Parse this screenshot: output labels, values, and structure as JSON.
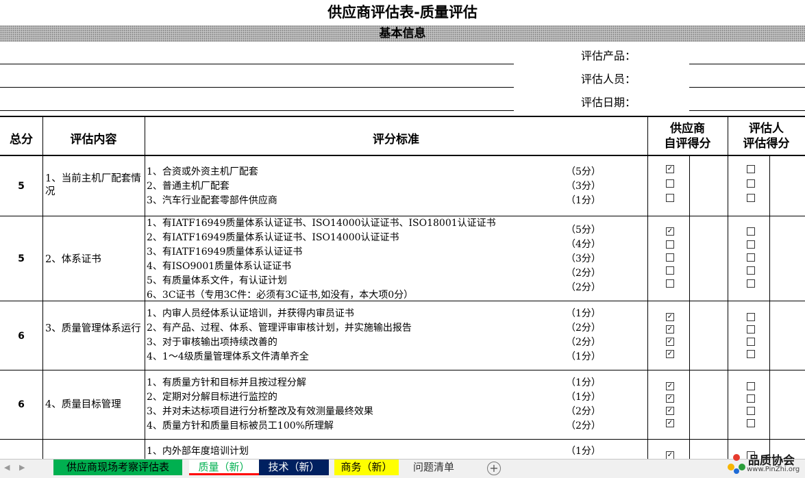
{
  "title": "供应商评估表-质量评估",
  "section_basic": "基本信息",
  "info_labels": [
    "评估产品：",
    "评估人员：",
    "评估日期："
  ],
  "headers": {
    "total": "总分",
    "content": "评估内容",
    "criteria": "评分标准",
    "supplier_line1": "供应商",
    "supplier_line2": "自评得分",
    "assessor_line1": "评估人",
    "assessor_line2": "评估得分"
  },
  "rows": [
    {
      "score": "5",
      "content": "1、当前主机厂配套情况",
      "items": [
        {
          "text": "1、合资或外资主机厂配套",
          "points": "（5分）",
          "supplier_checked": true,
          "assessor_checked": false
        },
        {
          "text": "2、普通主机厂配套",
          "points": "（3分）",
          "supplier_checked": false,
          "assessor_checked": false
        },
        {
          "text": "3、汽车行业配套零部件供应商",
          "points": "（1分）",
          "supplier_checked": false,
          "assessor_checked": false
        }
      ]
    },
    {
      "score": "5",
      "content": "2、体系证书",
      "items": [
        {
          "text": "1、有IATF16949质量体系认证证书、ISO14000认证证书、ISO18001认证证书",
          "points": "（5分）",
          "supplier_checked": true,
          "assessor_checked": false
        },
        {
          "text": "2、有IATF16949质量体系认证证书、ISO14000认证证书",
          "points": "（4分）",
          "supplier_checked": false,
          "assessor_checked": false
        },
        {
          "text": "3、有IATF16949质量体系认证证书",
          "points": "（3分）",
          "supplier_checked": false,
          "assessor_checked": false
        },
        {
          "text": "4、有ISO9001质量体系认证证书",
          "points": "（2分）",
          "supplier_checked": false,
          "assessor_checked": false
        },
        {
          "text": "5、有质量体系文件，有认证计划",
          "points": "（2分）",
          "supplier_checked": false,
          "assessor_checked": false
        },
        {
          "text": "6、3C证书（专用3C件：必须有3C证书,如没有，本大项0分）",
          "points": "",
          "supplier_checked": null,
          "assessor_checked": null
        }
      ]
    },
    {
      "score": "6",
      "content": "3、质量管理体系运行",
      "items": [
        {
          "text": "1、内审人员经体系认证培训，并获得内审员证书",
          "points": "（1分）",
          "supplier_checked": true,
          "assessor_checked": false
        },
        {
          "text": "2、有产品、过程、体系、管理评审审核计划，并实施输出报告",
          "points": "（2分）",
          "supplier_checked": true,
          "assessor_checked": false
        },
        {
          "text": "3、对于审核输出项持续改善的",
          "points": "（2分）",
          "supplier_checked": true,
          "assessor_checked": false
        },
        {
          "text": "4、1～4级质量管理体系文件清单齐全",
          "points": "（1分）",
          "supplier_checked": true,
          "assessor_checked": false
        }
      ]
    },
    {
      "score": "6",
      "content": "4、质量目标管理",
      "items": [
        {
          "text": "1、有质量方针和目标并且按过程分解",
          "points": "（1分）",
          "supplier_checked": true,
          "assessor_checked": false
        },
        {
          "text": "2、定期对分解目标进行监控的",
          "points": "（1分）",
          "supplier_checked": true,
          "assessor_checked": false
        },
        {
          "text": "3、并对未达标项目进行分析整改及有效测量最终效果",
          "points": "（2分）",
          "supplier_checked": true,
          "assessor_checked": false
        },
        {
          "text": "4、质量方针和质量目标被员工100%所理解",
          "points": "（2分）",
          "supplier_checked": true,
          "assessor_checked": false
        }
      ]
    },
    {
      "score": "",
      "content": "",
      "items": [
        {
          "text": "1、内外部年度培训计划",
          "points": "（1分）",
          "supplier_checked": true,
          "assessor_checked": false
        }
      ]
    }
  ],
  "sheet_tabs": [
    {
      "label": "供应商现场考察评估表",
      "color": "#00b050",
      "active": false
    },
    {
      "label": "质量（新）",
      "color": "#ffffff",
      "active": true
    },
    {
      "label": "技术（新）",
      "color": "#002060",
      "active": false
    },
    {
      "label": "商务（新）",
      "color": "#ffff00",
      "active": false
    },
    {
      "label": "问题清单",
      "color": "#f0f0f0",
      "active": false
    }
  ],
  "logo": {
    "text": "品质协会",
    "url": "www.PinZhi.org"
  },
  "add_sheet_icon": "plus-icon"
}
